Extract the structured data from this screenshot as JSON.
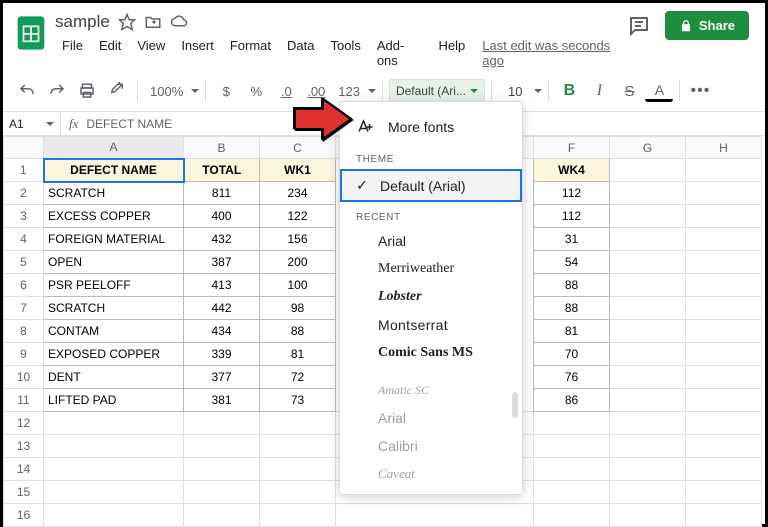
{
  "header": {
    "title": "sample",
    "last_edit": "Last edit was seconds ago",
    "share": "Share"
  },
  "menubar": [
    "File",
    "Edit",
    "View",
    "Insert",
    "Format",
    "Data",
    "Tools",
    "Add-ons",
    "Help"
  ],
  "toolbar": {
    "zoom": "100%",
    "currency": "$",
    "percent": "%",
    "dec_dec": ".0",
    "inc_dec": ".00",
    "numfmt": "123",
    "font": "Default (Ari...",
    "fontsize": "10",
    "bold": "B",
    "italic": "I",
    "strike": "S",
    "textcolor": "A",
    "more": "•••"
  },
  "fx": {
    "cell": "A1",
    "value": "DEFECT NAME"
  },
  "columns": [
    "",
    "A",
    "B",
    "C",
    "",
    "F",
    "G",
    "H"
  ],
  "sheet": {
    "headers": [
      "DEFECT NAME",
      "TOTAL",
      "WK1",
      "WK4"
    ],
    "rows": [
      {
        "n": "1"
      },
      {
        "n": "2",
        "a": "SCRATCH",
        "b": "811",
        "c": "234",
        "f": "112"
      },
      {
        "n": "3",
        "a": "EXCESS COPPER",
        "b": "400",
        "c": "122",
        "f": "112"
      },
      {
        "n": "4",
        "a": "FOREIGN MATERIAL",
        "b": "432",
        "c": "156",
        "f": "31"
      },
      {
        "n": "5",
        "a": "OPEN",
        "b": "387",
        "c": "200",
        "f": "54"
      },
      {
        "n": "6",
        "a": "PSR PEELOFF",
        "b": "413",
        "c": "100",
        "f": "88"
      },
      {
        "n": "7",
        "a": "SCRATCH",
        "b": "442",
        "c": "98",
        "f": "88"
      },
      {
        "n": "8",
        "a": "CONTAM",
        "b": "434",
        "c": "88",
        "f": "81"
      },
      {
        "n": "9",
        "a": "EXPOSED COPPER",
        "b": "339",
        "c": "81",
        "f": "70"
      },
      {
        "n": "10",
        "a": "DENT",
        "b": "377",
        "c": "72",
        "f": "76"
      },
      {
        "n": "11",
        "a": "LIFTED PAD",
        "b": "381",
        "c": "73",
        "f": "86"
      },
      {
        "n": "12"
      },
      {
        "n": "13"
      },
      {
        "n": "14"
      },
      {
        "n": "15"
      },
      {
        "n": "16"
      }
    ]
  },
  "fontdd": {
    "more": "More fonts",
    "sec_theme": "THEME",
    "default_arial": "Default (Arial)",
    "sec_recent": "RECENT",
    "recent": [
      "Arial",
      "Merriweather",
      "Lobster",
      "Montserrat",
      "Comic Sans MS"
    ],
    "other": [
      "Amatic SC",
      "Arial",
      "Calibri",
      "Caveat"
    ]
  }
}
